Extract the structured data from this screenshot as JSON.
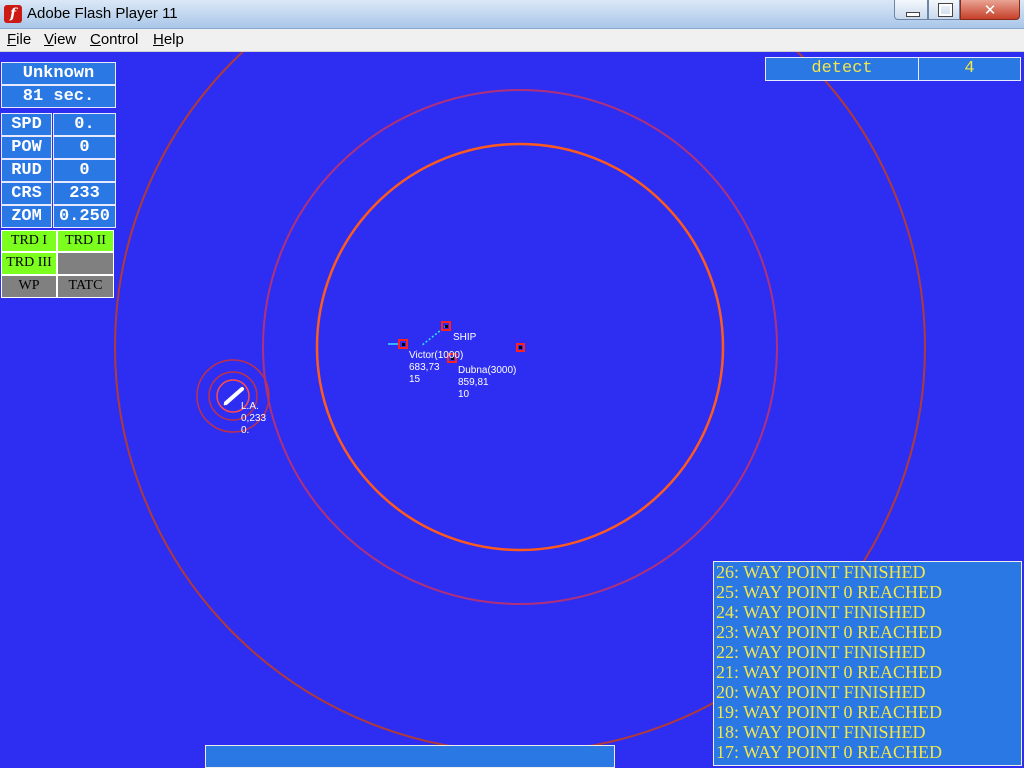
{
  "window": {
    "title": "Adobe Flash Player 11",
    "app_icon_glyph": "f"
  },
  "menu": [
    "File",
    "View",
    "Control",
    "Help"
  ],
  "status": {
    "target": "Unknown",
    "time": "81 sec."
  },
  "readouts": [
    {
      "label": "SPD",
      "value": "0."
    },
    {
      "label": "POW",
      "value": "0"
    },
    {
      "label": "RUD",
      "value": "0"
    },
    {
      "label": "CRS",
      "value": "233"
    },
    {
      "label": "ZOM",
      "value": "0.250"
    }
  ],
  "modes": [
    {
      "label": "TRD I",
      "state": "active"
    },
    {
      "label": "TRD II",
      "state": "active"
    },
    {
      "label": "TRD III",
      "state": "active"
    },
    {
      "label": "",
      "state": "inactive"
    },
    {
      "label": "WP",
      "state": "inactive"
    },
    {
      "label": "TATC",
      "state": "inactive"
    }
  ],
  "detect": {
    "label": "detect",
    "count": "4"
  },
  "contacts": [
    {
      "name": "SHIP",
      "lines": []
    },
    {
      "name": "Victor(1000)",
      "lines": [
        "683,73",
        "15"
      ]
    },
    {
      "name": "Dubna(3000)",
      "lines": [
        "859,81",
        "10"
      ]
    },
    {
      "name": "L.A.",
      "lines": [
        "0,233",
        "0."
      ]
    }
  ],
  "log": [
    "26: WAY POINT FINISHED",
    "25: WAY POINT 0 REACHED",
    "24: WAY POINT FINISHED",
    "23: WAY POINT 0 REACHED",
    "22: WAY POINT FINISHED",
    "21: WAY POINT 0 REACHED",
    "20: WAY POINT FINISHED",
    "19: WAY POINT 0 REACHED",
    "18: WAY POINT FINISHED",
    "17: WAY POINT 0 REACHED"
  ],
  "colors": {
    "sea": "#2e2ef2",
    "panel": "#2a78e4",
    "mode_active": "#7cff1e",
    "mode_inactive": "#808080",
    "detect_text": "#f2e64a",
    "log_text": "#f2e64a",
    "range_ring_outer": "#b03a3a",
    "range_ring_mid": "#b0307a",
    "range_ring_inner": "#ff5a1e"
  }
}
